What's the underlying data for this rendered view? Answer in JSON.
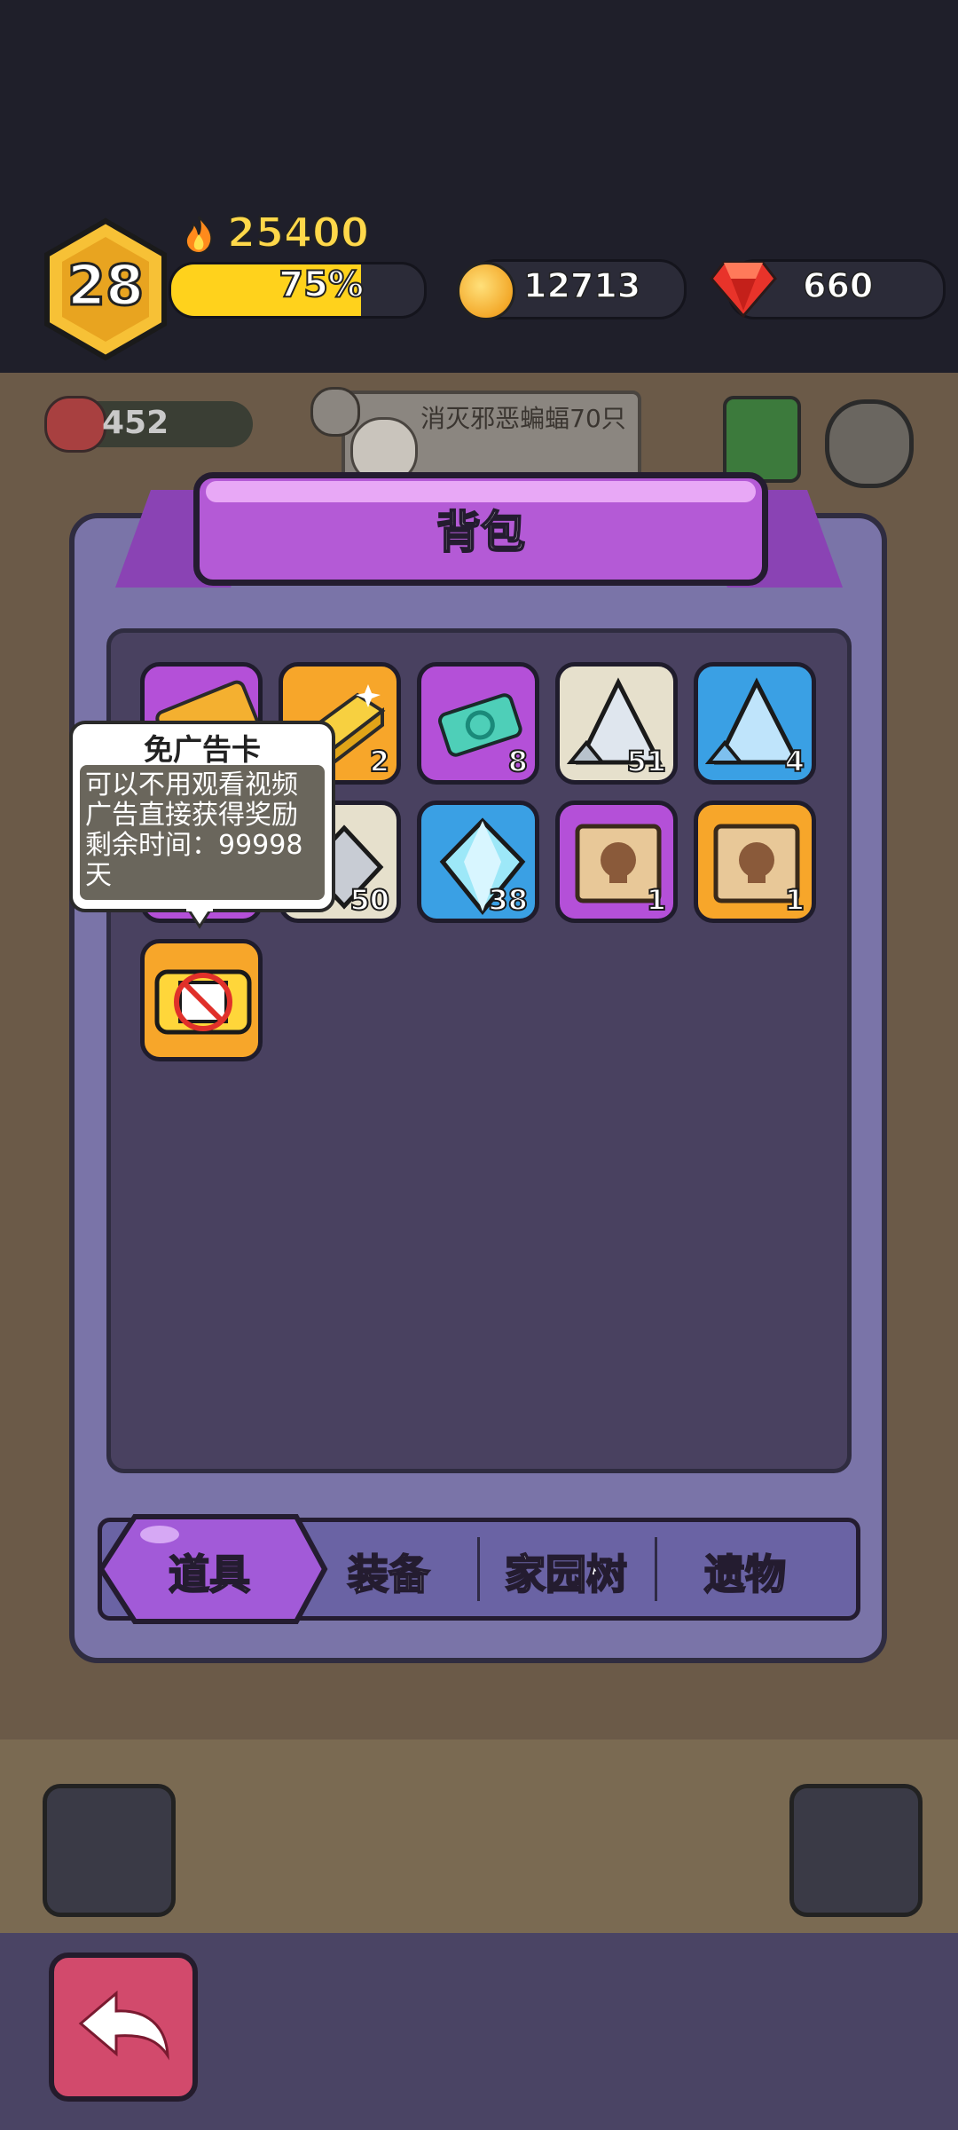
{
  "player": {
    "level": "28",
    "power": "25400",
    "xp_percent_label": "75%",
    "xp_fraction": 0.75
  },
  "currency": {
    "coins": "12713",
    "gems": "660"
  },
  "background": {
    "meat_count": "452",
    "quest_text": "消灭邪恶蝙蝠70只"
  },
  "panel": {
    "title": "背包"
  },
  "items": [
    {
      "name": "免广告卡",
      "frame": "purple",
      "icon": "ticket-icon",
      "count": ""
    },
    {
      "name": "gold-bar",
      "frame": "gold",
      "icon": "gold-bar-icon",
      "count": "2"
    },
    {
      "name": "refresh-ticket",
      "frame": "purple",
      "icon": "refresh-ticket-icon",
      "count": "8"
    },
    {
      "name": "gray-ore",
      "frame": "cream",
      "icon": "gray-ore-icon",
      "count": "51"
    },
    {
      "name": "blue-ore",
      "frame": "blue",
      "icon": "blue-ore-icon",
      "count": "4"
    },
    {
      "name": "hidden-item",
      "frame": "purple",
      "icon": "hidden-icon",
      "count": ""
    },
    {
      "name": "silver-crystal",
      "frame": "cream",
      "icon": "silver-crystal-icon",
      "count": "50"
    },
    {
      "name": "blue-diamond",
      "frame": "blue",
      "icon": "diamond-icon",
      "count": "38"
    },
    {
      "name": "skull-map-purple",
      "frame": "purple",
      "icon": "skull-map-icon",
      "count": "1"
    },
    {
      "name": "skull-map-gold",
      "frame": "gold",
      "icon": "skull-map-icon",
      "count": "1"
    },
    {
      "name": "no-ad-video-card",
      "frame": "gold",
      "icon": "no-video-icon",
      "count": ""
    }
  ],
  "tooltip": {
    "title": "免广告卡",
    "line1": "可以不用观看视频",
    "line2": "广告直接获得奖励",
    "line3": "剩余时间：99998",
    "line4": "天"
  },
  "tabs": [
    {
      "label": "道具",
      "active": true
    },
    {
      "label": "装备",
      "active": false
    },
    {
      "label": "家园树",
      "active": false
    },
    {
      "label": "遗物",
      "active": false
    }
  ],
  "colors": {
    "accent_purple": "#b45ad6",
    "panel": "#7a74a8",
    "xp_bar": "#ffd21c",
    "back_button": "#d24a6c"
  }
}
